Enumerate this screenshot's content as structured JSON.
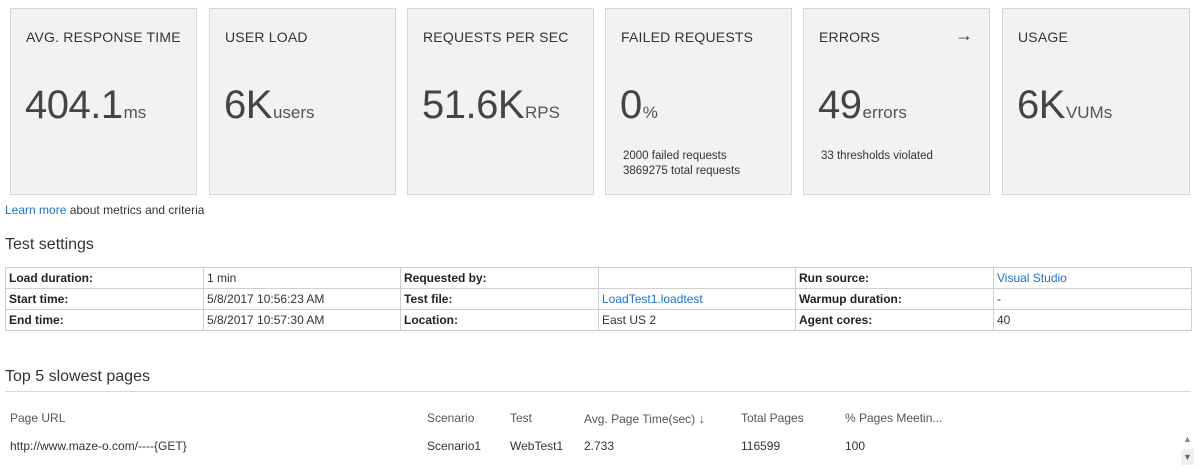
{
  "cards": [
    {
      "title": "AVG. RESPONSE TIME",
      "value": "404.1",
      "unit": "ms",
      "sub1": "",
      "sub2": ""
    },
    {
      "title": "USER LOAD",
      "value": "6K",
      "unit": "users",
      "sub1": "",
      "sub2": ""
    },
    {
      "title": "REQUESTS PER SEC",
      "value": "51.6K",
      "unit": "RPS",
      "sub1": "",
      "sub2": ""
    },
    {
      "title": "FAILED REQUESTS",
      "value": "0",
      "unit": "%",
      "sub1": "2000 failed requests",
      "sub2": "3869275 total requests"
    },
    {
      "title": "ERRORS",
      "value": "49",
      "unit": "errors",
      "sub1": "33 thresholds violated",
      "sub2": "",
      "arrow": "→"
    },
    {
      "title": "USAGE",
      "value": "6K",
      "unit": "VUMs",
      "sub1": "",
      "sub2": ""
    }
  ],
  "learn": {
    "link": "Learn more",
    "text": " about metrics and criteria"
  },
  "settings": {
    "title": "Test settings",
    "rows": [
      [
        {
          "label": "Load duration:",
          "value": "1 min"
        },
        {
          "label": "Requested by:",
          "value": ""
        },
        {
          "label": "Run source:",
          "value": "Visual Studio",
          "link": true
        }
      ],
      [
        {
          "label": "Start time:",
          "value": "5/8/2017 10:56:23 AM"
        },
        {
          "label": "Test file:",
          "value": "LoadTest1.loadtest",
          "link": true
        },
        {
          "label": "Warmup duration:",
          "value": "-"
        }
      ],
      [
        {
          "label": "End time:",
          "value": "5/8/2017 10:57:30 AM"
        },
        {
          "label": "Location:",
          "value": "East US 2"
        },
        {
          "label": "Agent cores:",
          "value": "40"
        }
      ]
    ]
  },
  "pages": {
    "title": "Top 5 slowest pages",
    "columns": [
      "Page URL",
      "Scenario",
      "Test",
      "Avg. Page Time(sec)",
      "Total Pages",
      "% Pages Meetin..."
    ],
    "sort_arrow": "↓",
    "rows": [
      [
        "http://www.maze-o.com/----{GET}",
        "Scenario1",
        "WebTest1",
        "2.733",
        "116599",
        "100"
      ]
    ]
  },
  "scroll": {
    "up": "▲",
    "down": "▼"
  }
}
